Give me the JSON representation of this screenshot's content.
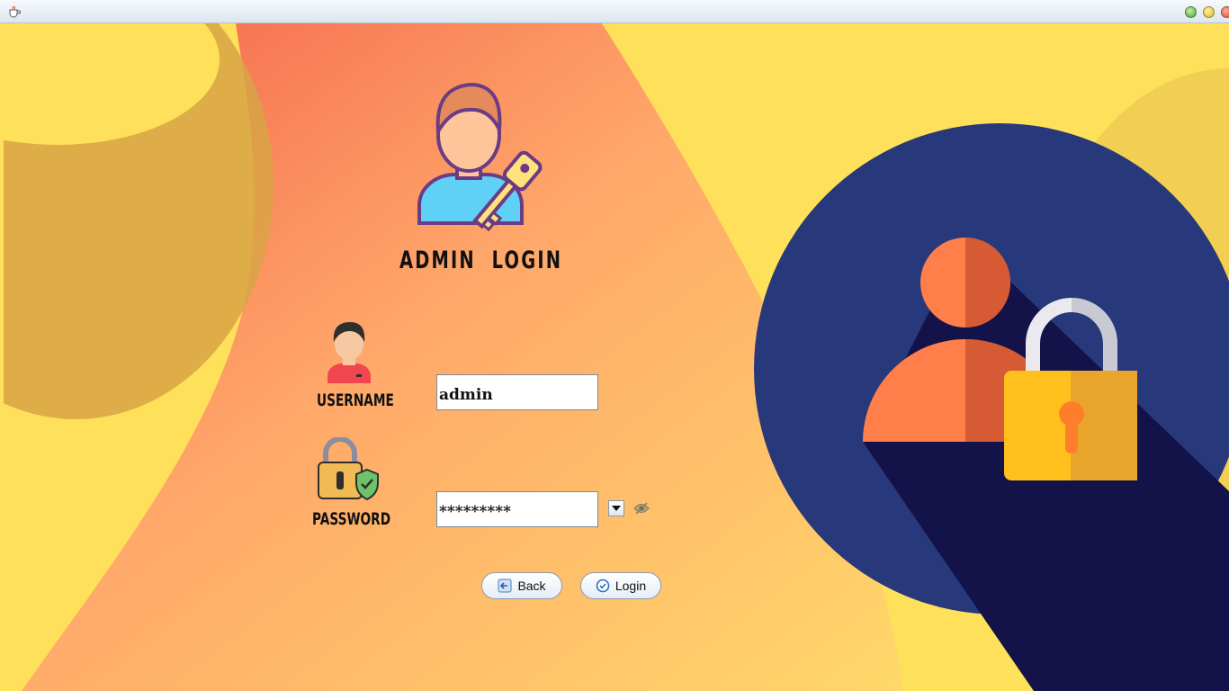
{
  "window": {
    "title": ""
  },
  "login": {
    "heading": "ADMIN  LOGIN",
    "username_label": "USERNAME",
    "username_value": "admin",
    "password_label": "PASSWORD",
    "password_value": "*********",
    "show_password_checked": true
  },
  "buttons": {
    "back_label": "Back",
    "login_label": "Login"
  },
  "icons": {
    "app": "java-cup-icon",
    "admin": "admin-key-icon",
    "user": "user-avatar-icon",
    "password": "padlock-shield-icon",
    "eye": "eye-hidden-icon",
    "back": "back-arrow-icon",
    "login": "check-circle-icon",
    "hero": "user-lock-icon"
  },
  "colors": {
    "background": "#ffe05a",
    "accent_red": "#f4634b",
    "circle": "#27397a",
    "lock": "#ffc01e"
  }
}
